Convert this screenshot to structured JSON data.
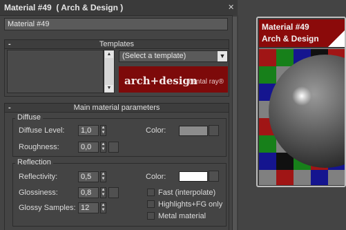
{
  "window": {
    "title": "Material #49  ( Arch & Design )"
  },
  "material_name": "Material #49",
  "templates": {
    "header": "Templates",
    "select_value": "(Select a template)",
    "banner_main": "arch+design",
    "banner_sub": "mental ray®"
  },
  "main": {
    "header": "Main material parameters",
    "diffuse": {
      "title": "Diffuse",
      "level_label": "Diffuse Level:",
      "level_value": "1,0",
      "roughness_label": "Roughness:",
      "roughness_value": "0,0",
      "color_label": "Color:",
      "color": "#8c8c8c"
    },
    "reflection": {
      "title": "Reflection",
      "reflectivity_label": "Reflectivity:",
      "reflectivity_value": "0,5",
      "glossiness_label": "Glossiness:",
      "glossiness_value": "0,8",
      "samples_label": "Glossy Samples:",
      "samples_value": "12",
      "color_label": "Color:",
      "color": "#ffffff",
      "fast_label": "Fast (interpolate)",
      "highlights_label": "Highlights+FG only",
      "metal_label": "Metal material"
    }
  },
  "preview": {
    "line1": "Material #49",
    "line2": "Arch & Design"
  }
}
